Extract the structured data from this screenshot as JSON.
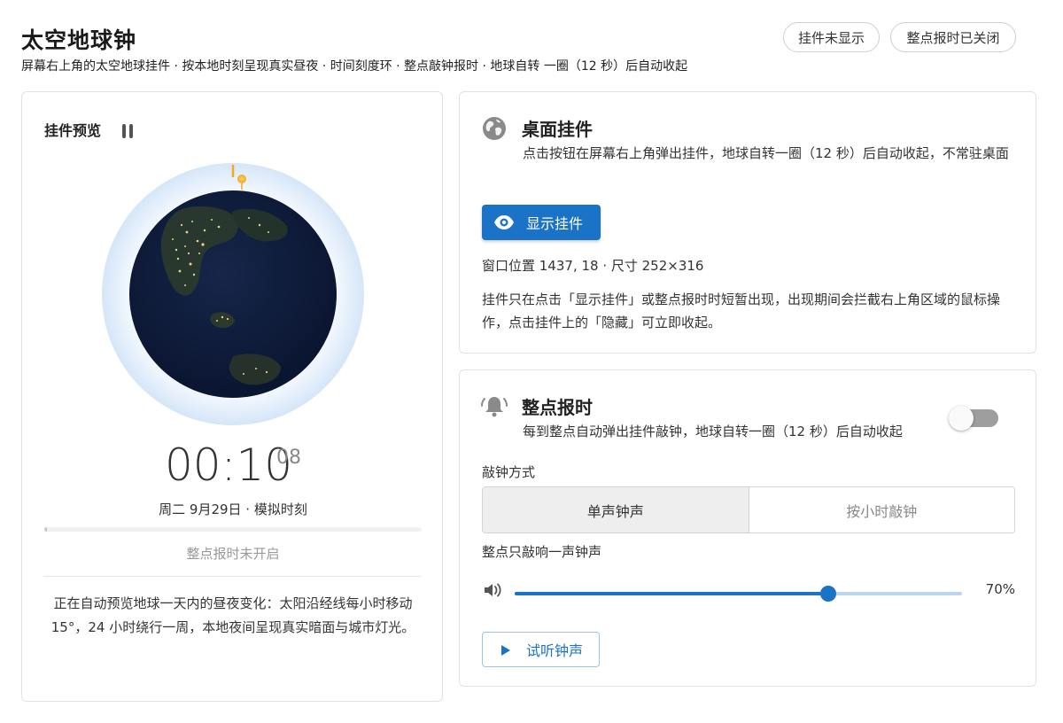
{
  "header": {
    "title": "太空地球钟",
    "subtitle": "屏幕右上角的太空地球挂件 · 按本地时刻呈现真实昼夜 · 时间刻度环 · 整点敲钟报时 · 地球自转 一圈（12 秒）后自动收起",
    "status_widget": "挂件未显示",
    "status_chime": "整点报时已关闭"
  },
  "preview": {
    "title": "挂件预览",
    "time_main": "00:10",
    "time_seconds": "08",
    "date": "周二 9月29日 · 模拟时刻",
    "day_progress_fraction": 0.007,
    "chime_status": "整点报时未开启",
    "description": "正在自动预览地球一天内的昼夜变化：太阳沿经线每小时移动 15°，24 小时绕行一周，本地夜间呈现真实暗面与城市灯光。"
  },
  "desktop_widget": {
    "icon": "globe-icon",
    "title": "桌面挂件",
    "description": "点击按钮在屏幕右上角弹出挂件，地球自转一圈（12 秒）后自动收起，不常驻桌面",
    "show_button": "显示挂件",
    "window_info": "窗口位置 1437, 18 · 尺寸 252×316",
    "note": "挂件只在点击「显示挂件」或整点报时时短暂出现，出现期间会拦截右上角区域的鼠标操作，点击挂件上的「隐藏」可立即收起。"
  },
  "hourly_chime": {
    "icon": "bell-icon",
    "title": "整点报时",
    "description": "每到整点自动弹出挂件敲钟，地球自转一圈（12 秒）后自动收起",
    "enabled": false,
    "mode_label": "敲钟方式",
    "modes": [
      "单声钟声",
      "按小时敲钟"
    ],
    "selected_mode": "单声钟声",
    "mode_hint": "整点只敲响一声钟声",
    "volume_value": 70,
    "volume_label": "70%",
    "test_button": "试听钟声"
  },
  "colors": {
    "accent": "#1a73c7",
    "toggle_off": "#9e9e9e",
    "globe_ocean": "#0d1a36"
  }
}
